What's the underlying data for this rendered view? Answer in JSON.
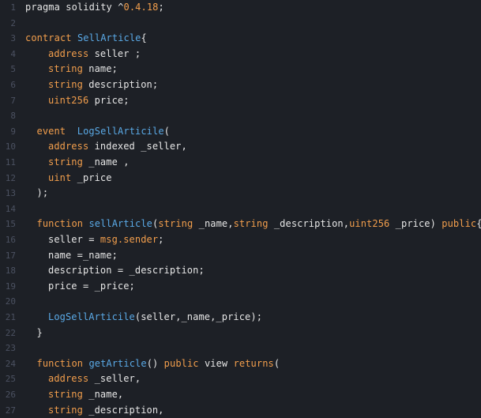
{
  "colors": {
    "background": "#1d2026",
    "line_number": "#4b5161",
    "text": "#e6e6e6",
    "keyword": "#f29e4c",
    "function": "#5aa9e6",
    "number": "#f29e4c"
  },
  "lines": [
    {
      "num": "1",
      "indent": 0,
      "tokens": [
        {
          "t": "plain",
          "v": "pragma solidity ^"
        },
        {
          "t": "num",
          "v": "0.4.18"
        },
        {
          "t": "plain",
          "v": ";"
        }
      ]
    },
    {
      "num": "2",
      "indent": 0,
      "tokens": []
    },
    {
      "num": "3",
      "indent": 0,
      "tokens": [
        {
          "t": "kw",
          "v": "contract"
        },
        {
          "t": "plain",
          "v": " "
        },
        {
          "t": "fn",
          "v": "SellArticle"
        },
        {
          "t": "plain",
          "v": "{"
        }
      ]
    },
    {
      "num": "4",
      "indent": 4,
      "tokens": [
        {
          "t": "kw",
          "v": "address"
        },
        {
          "t": "plain",
          "v": " seller ;"
        }
      ]
    },
    {
      "num": "5",
      "indent": 4,
      "tokens": [
        {
          "t": "kw",
          "v": "string"
        },
        {
          "t": "plain",
          "v": " name;"
        }
      ]
    },
    {
      "num": "6",
      "indent": 4,
      "tokens": [
        {
          "t": "kw",
          "v": "string"
        },
        {
          "t": "plain",
          "v": " description;"
        }
      ]
    },
    {
      "num": "7",
      "indent": 4,
      "tokens": [
        {
          "t": "kw",
          "v": "uint256"
        },
        {
          "t": "plain",
          "v": " price;"
        }
      ]
    },
    {
      "num": "8",
      "indent": 0,
      "tokens": []
    },
    {
      "num": "9",
      "indent": 2,
      "tokens": [
        {
          "t": "kw",
          "v": "event"
        },
        {
          "t": "plain",
          "v": "  "
        },
        {
          "t": "fn",
          "v": "LogSellArticile"
        },
        {
          "t": "plain",
          "v": "("
        }
      ]
    },
    {
      "num": "10",
      "indent": 4,
      "tokens": [
        {
          "t": "kw",
          "v": "address"
        },
        {
          "t": "plain",
          "v": " indexed _seller,"
        }
      ]
    },
    {
      "num": "11",
      "indent": 4,
      "tokens": [
        {
          "t": "kw",
          "v": "string"
        },
        {
          "t": "plain",
          "v": " _name ,"
        }
      ]
    },
    {
      "num": "12",
      "indent": 4,
      "tokens": [
        {
          "t": "kw",
          "v": "uint"
        },
        {
          "t": "plain",
          "v": " _price"
        }
      ]
    },
    {
      "num": "13",
      "indent": 2,
      "tokens": [
        {
          "t": "plain",
          "v": ");"
        }
      ]
    },
    {
      "num": "14",
      "indent": 0,
      "tokens": []
    },
    {
      "num": "15",
      "indent": 2,
      "tokens": [
        {
          "t": "kw",
          "v": "function"
        },
        {
          "t": "plain",
          "v": " "
        },
        {
          "t": "fn",
          "v": "sellArticle"
        },
        {
          "t": "plain",
          "v": "("
        },
        {
          "t": "kw",
          "v": "string"
        },
        {
          "t": "plain",
          "v": " _name,"
        },
        {
          "t": "kw",
          "v": "string"
        },
        {
          "t": "plain",
          "v": " _description,"
        },
        {
          "t": "kw",
          "v": "uint256"
        },
        {
          "t": "plain",
          "v": " _price) "
        },
        {
          "t": "kw",
          "v": "public"
        },
        {
          "t": "plain",
          "v": "{"
        }
      ]
    },
    {
      "num": "16",
      "indent": 4,
      "tokens": [
        {
          "t": "plain",
          "v": "seller = "
        },
        {
          "t": "kw",
          "v": "msg.sender"
        },
        {
          "t": "plain",
          "v": ";"
        }
      ]
    },
    {
      "num": "17",
      "indent": 4,
      "tokens": [
        {
          "t": "plain",
          "v": "name =_name;"
        }
      ]
    },
    {
      "num": "18",
      "indent": 4,
      "tokens": [
        {
          "t": "plain",
          "v": "description = _description;"
        }
      ]
    },
    {
      "num": "19",
      "indent": 4,
      "tokens": [
        {
          "t": "plain",
          "v": "price = _price;"
        }
      ]
    },
    {
      "num": "20",
      "indent": 0,
      "tokens": []
    },
    {
      "num": "21",
      "indent": 4,
      "tokens": [
        {
          "t": "fn",
          "v": "LogSellArticile"
        },
        {
          "t": "plain",
          "v": "(seller,_name,_price);"
        }
      ]
    },
    {
      "num": "22",
      "indent": 2,
      "tokens": [
        {
          "t": "plain",
          "v": "}"
        }
      ]
    },
    {
      "num": "23",
      "indent": 0,
      "tokens": []
    },
    {
      "num": "24",
      "indent": 2,
      "tokens": [
        {
          "t": "kw",
          "v": "function"
        },
        {
          "t": "plain",
          "v": " "
        },
        {
          "t": "fn",
          "v": "getArticle"
        },
        {
          "t": "plain",
          "v": "() "
        },
        {
          "t": "kw",
          "v": "public"
        },
        {
          "t": "plain",
          "v": " view "
        },
        {
          "t": "kw",
          "v": "returns"
        },
        {
          "t": "plain",
          "v": "("
        }
      ]
    },
    {
      "num": "25",
      "indent": 4,
      "tokens": [
        {
          "t": "kw",
          "v": "address"
        },
        {
          "t": "plain",
          "v": " _seller,"
        }
      ]
    },
    {
      "num": "26",
      "indent": 4,
      "tokens": [
        {
          "t": "kw",
          "v": "string"
        },
        {
          "t": "plain",
          "v": " _name,"
        }
      ]
    },
    {
      "num": "27",
      "indent": 4,
      "tokens": [
        {
          "t": "kw",
          "v": "string"
        },
        {
          "t": "plain",
          "v": " _description,"
        }
      ]
    }
  ]
}
